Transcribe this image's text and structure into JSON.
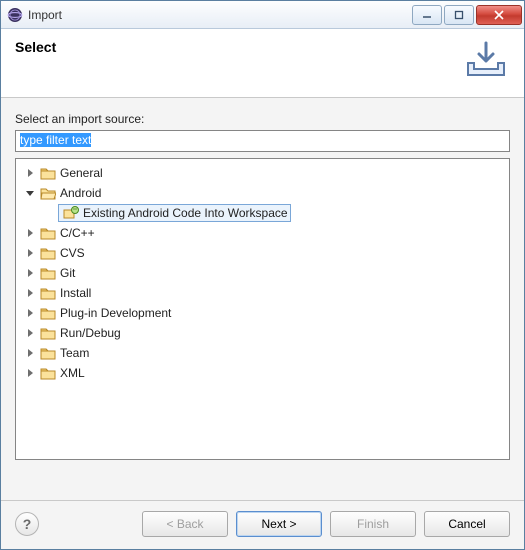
{
  "titlebar": {
    "title": "Import"
  },
  "banner": {
    "heading": "Select"
  },
  "field": {
    "label": "Select an import source:"
  },
  "filter": {
    "text": "type filter text"
  },
  "tree": {
    "items": [
      {
        "label": "General"
      },
      {
        "label": "Android"
      },
      {
        "label": "Existing Android Code Into Workspace"
      },
      {
        "label": "C/C++"
      },
      {
        "label": "CVS"
      },
      {
        "label": "Git"
      },
      {
        "label": "Install"
      },
      {
        "label": "Plug-in Development"
      },
      {
        "label": "Run/Debug"
      },
      {
        "label": "Team"
      },
      {
        "label": "XML"
      }
    ]
  },
  "buttons": {
    "back": "< Back",
    "next": "Next >",
    "finish": "Finish",
    "cancel": "Cancel",
    "help": "?"
  }
}
